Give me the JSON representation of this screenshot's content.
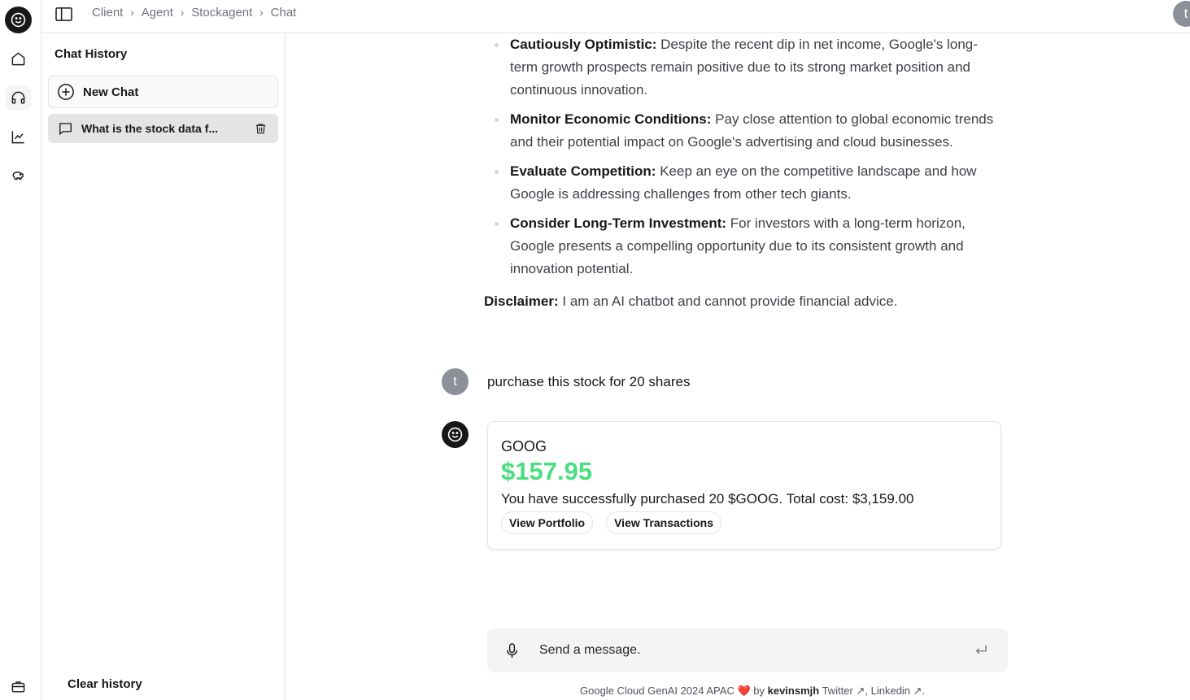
{
  "breadcrumb": [
    "Client",
    "Agent",
    "Stockagent",
    "Chat"
  ],
  "user_initial": "t",
  "history": {
    "title": "Chat History",
    "new_chat_label": "New Chat",
    "items": [
      {
        "label": "What is the stock data f..."
      }
    ],
    "clear_label": "Clear history"
  },
  "answer": {
    "bullets": [
      {
        "title": "Cautiously Optimistic:",
        "text": " Despite the recent dip in net income, Google's long-term growth prospects remain positive due to its strong market position and continuous innovation."
      },
      {
        "title": "Monitor Economic Conditions:",
        "text": " Pay close attention to global economic trends and their potential impact on Google's advertising and cloud businesses."
      },
      {
        "title": "Evaluate Competition:",
        "text": " Keep an eye on the competitive landscape and how Google is addressing challenges from other tech giants."
      },
      {
        "title": "Consider Long-Term Investment:",
        "text": " For investors with a long-term horizon, Google presents a compelling opportunity due to its consistent growth and innovation potential."
      }
    ],
    "disclaimer_title": "Disclaimer:",
    "disclaimer_text": " I am an AI chatbot and cannot provide financial advice."
  },
  "user_message": "purchase this stock for 20 shares",
  "stock_card": {
    "ticker": "GOOG",
    "price": "$157.95",
    "message": "You have successfully purchased 20 $GOOG. Total cost: $3,159.00",
    "buttons": [
      "View Portfolio",
      "View Transactions"
    ]
  },
  "composer": {
    "placeholder": "Send a message."
  },
  "footer": {
    "prefix": "Google Cloud GenAI 2024 APAC ",
    "heart": "❤️",
    "by": " by ",
    "author": "kevinsmjh",
    "twitter": " Twitter ↗",
    "comma": ",",
    "linkedin": " Linkedin ↗",
    "end": "."
  },
  "colors": {
    "accent_price": "#4ade80",
    "dark": "#18181b",
    "avatar_gray": "#8b9099"
  }
}
